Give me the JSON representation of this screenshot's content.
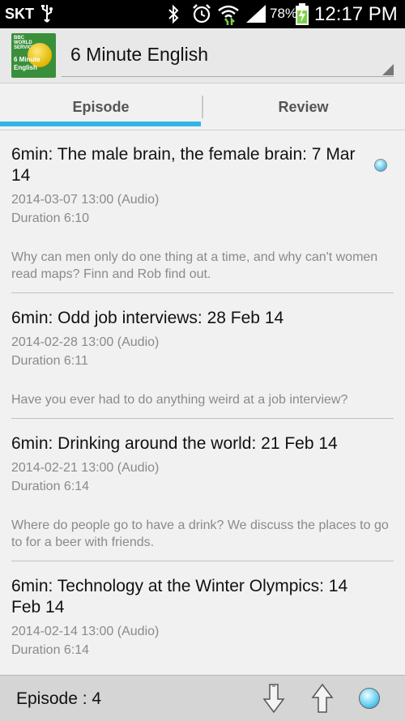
{
  "status_bar": {
    "carrier": "SKT",
    "battery_percent": "78%",
    "time": "12:17 PM",
    "icons": [
      "usb-icon",
      "bluetooth-icon",
      "alarm-icon",
      "wifi-icon",
      "signal-icon",
      "battery-charging-icon"
    ]
  },
  "app_bar": {
    "icon_text_top": "BBC WORLD SERVICE",
    "icon_text_line1": "6 Minute",
    "icon_text_line2": "English",
    "title": "6 Minute English"
  },
  "tabs": [
    {
      "label": "Episode",
      "selected": true
    },
    {
      "label": "Review",
      "selected": false
    }
  ],
  "accent_color": "#33b5e5",
  "episodes": [
    {
      "title": "6min: The male brain, the female brain: 7 Mar 14",
      "date": "2014-03-07 13:00 (Audio)",
      "duration": "Duration  6:10",
      "description": "Why can men only do one thing at a time, and why can't women read maps? Finn and Rob find out.",
      "selected": true
    },
    {
      "title": "6min: Odd job interviews: 28 Feb 14",
      "date": "2014-02-28 13:00 (Audio)",
      "duration": "Duration  6:11",
      "description": "Have you ever had to do anything weird at a job interview?"
    },
    {
      "title": "6min: Drinking around the world: 21 Feb 14",
      "date": "2014-02-21 13:00 (Audio)",
      "duration": "Duration  6:14",
      "description": "Where do people go to have a drink? We discuss the places to go to for a beer with friends."
    },
    {
      "title": "6min: Technology at the Winter Olympics: 14 Feb 14",
      "date": "2014-02-14 13:00 (Audio)",
      "duration": "Duration  6:14",
      "description": ""
    }
  ],
  "bottom_bar": {
    "episode_count": "Episode : 4",
    "icons": [
      "arrow-down-icon",
      "arrow-up-icon",
      "play-indicator-icon"
    ]
  }
}
